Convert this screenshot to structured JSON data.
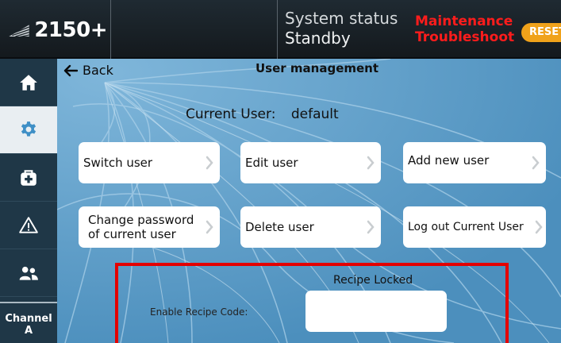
{
  "header": {
    "logo_text": "2150+",
    "status_label": "System status",
    "status_value": "Standby",
    "alert_lines": [
      "Maintenance",
      "Troubleshoot"
    ],
    "reset_label": "RESET",
    "colors": {
      "alert": "#ff1c1c",
      "reset": "#f0a21a"
    }
  },
  "sidebar": {
    "items": [
      {
        "icon": "home-icon",
        "active": false
      },
      {
        "icon": "gear-icon",
        "active": true
      },
      {
        "icon": "toolbox-icon",
        "active": false
      },
      {
        "icon": "warning-icon",
        "active": false
      },
      {
        "icon": "users-icon",
        "active": false
      }
    ],
    "channel_lines": [
      "Channel",
      "A"
    ]
  },
  "main": {
    "back_label": "Back",
    "title": "User management",
    "current_user_label": "Current User:",
    "current_user_value": "default",
    "buttons": [
      {
        "label": "Switch user"
      },
      {
        "label": "Edit user"
      },
      {
        "label": "Add new user"
      },
      {
        "label_lines": [
          "Change password",
          "of current user"
        ]
      },
      {
        "label": "Delete user"
      },
      {
        "label": "Log out Current User"
      }
    ],
    "recipe": {
      "title": "Recipe Locked",
      "enable_label": "Enable Recipe Code:",
      "code_value": "",
      "highlight_color": "#e30000"
    }
  }
}
